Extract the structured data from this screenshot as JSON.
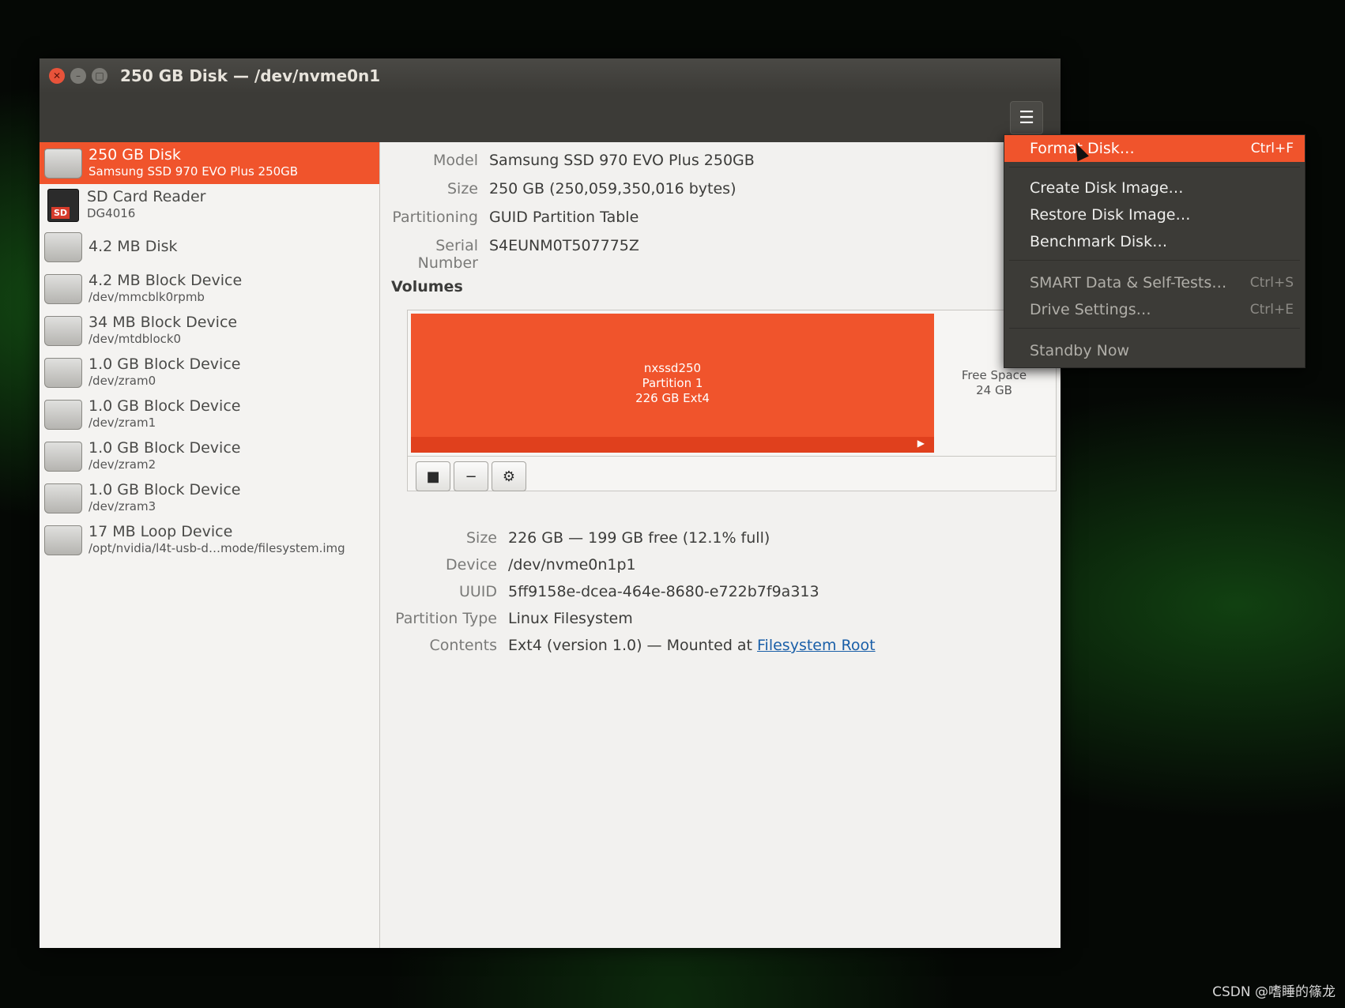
{
  "window": {
    "title": "250 GB Disk — /dev/nvme0n1",
    "close_glyph": "✕",
    "min_glyph": "–",
    "max_glyph": "□",
    "menu_glyph": "☰"
  },
  "sidebar": {
    "items": [
      {
        "name": "250 GB Disk",
        "sub": "Samsung SSD 970 EVO Plus 250GB",
        "icon": "hard-disk-icon",
        "selected": true
      },
      {
        "name": "SD Card Reader",
        "sub": "DG4016",
        "icon": "sd-card-icon"
      },
      {
        "name": "4.2 MB Disk",
        "sub": "",
        "icon": "hard-disk-icon"
      },
      {
        "name": "4.2 MB Block Device",
        "sub": "/dev/mmcblk0rpmb",
        "icon": "drive-icon"
      },
      {
        "name": "34 MB Block Device",
        "sub": "/dev/mtdblock0",
        "icon": "drive-icon"
      },
      {
        "name": "1.0 GB Block Device",
        "sub": "/dev/zram0",
        "icon": "drive-icon"
      },
      {
        "name": "1.0 GB Block Device",
        "sub": "/dev/zram1",
        "icon": "drive-icon"
      },
      {
        "name": "1.0 GB Block Device",
        "sub": "/dev/zram2",
        "icon": "drive-icon"
      },
      {
        "name": "1.0 GB Block Device",
        "sub": "/dev/zram3",
        "icon": "drive-icon"
      },
      {
        "name": "17 MB Loop Device",
        "sub": "/opt/nvidia/l4t-usb-d…mode/filesystem.img",
        "icon": "drive-icon"
      }
    ]
  },
  "disk_info": {
    "model_label": "Model",
    "model": "Samsung SSD 970 EVO Plus 250GB",
    "size_label": "Size",
    "size": "250 GB (250,059,350,016 bytes)",
    "partitioning_label": "Partitioning",
    "partitioning": "GUID Partition Table",
    "serial_label": "Serial Number",
    "serial": "S4EUNM0T507775Z"
  },
  "volumes": {
    "title": "Volumes",
    "partition": {
      "name": "nxssd250",
      "label": "Partition 1",
      "desc": "226 GB Ext4"
    },
    "free": {
      "label": "Free Space",
      "size": "24 GB"
    },
    "tools": {
      "stop": "■",
      "remove": "−",
      "settings": "⚙"
    }
  },
  "partition_info": {
    "size_label": "Size",
    "size": "226 GB — 199 GB free (12.1% full)",
    "device_label": "Device",
    "device": "/dev/nvme0n1p1",
    "uuid_label": "UUID",
    "uuid": "5ff9158e-dcea-464e-8680-e722b7f9a313",
    "type_label": "Partition Type",
    "type": "Linux Filesystem",
    "contents_label": "Contents",
    "contents": "Ext4 (version 1.0) — Mounted at",
    "mount_link": "Filesystem Root"
  },
  "menu": {
    "items": [
      {
        "label": "Format Disk…",
        "accel": "Ctrl+F",
        "highlighted": true
      },
      {
        "label": "Create Disk Image…",
        "accel": ""
      },
      {
        "label": "Restore Disk Image…",
        "accel": ""
      },
      {
        "label": "Benchmark Disk…",
        "accel": ""
      },
      {
        "label": "SMART Data & Self-Tests…",
        "accel": "Ctrl+S",
        "disabled": true
      },
      {
        "label": "Drive Settings…",
        "accel": "Ctrl+E",
        "disabled": true
      },
      {
        "label": "Standby Now",
        "accel": "",
        "disabled": true
      }
    ]
  },
  "watermark": "CSDN @嗜睡的篠龙",
  "colors": {
    "accent": "#f0542c",
    "titlebar": "#3c3b37",
    "link": "#1a5fa8"
  }
}
